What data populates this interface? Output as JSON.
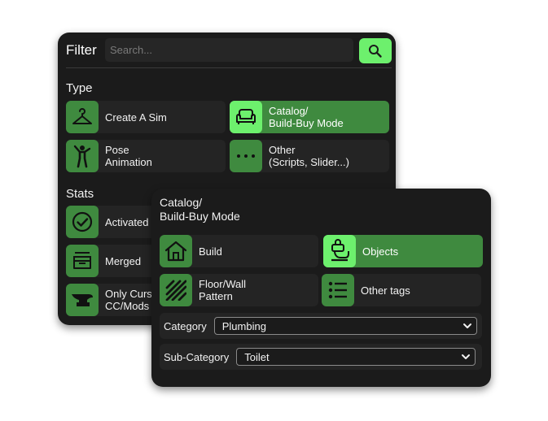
{
  "filter": {
    "title": "Filter",
    "search_placeholder": "Search...",
    "type_label": "Type",
    "stats_label": "Stats",
    "type_items": [
      {
        "label": "Create A Sim",
        "icon": "hanger-icon",
        "active": false
      },
      {
        "label": "Catalog/\nBuild-Buy Mode",
        "icon": "sofa-icon",
        "active": true
      },
      {
        "label": "Pose\nAnimation",
        "icon": "pose-icon",
        "active": false
      },
      {
        "label": "Other\n(Scripts, Slider...)",
        "icon": "ellipsis-icon",
        "active": false
      }
    ],
    "stats_items": [
      {
        "label": "Activated",
        "icon": "check-circle-icon"
      },
      {
        "label": "Merged",
        "icon": "merge-box-icon"
      },
      {
        "label": "Only Curs\nCC/Mods",
        "icon": "anvil-icon"
      }
    ]
  },
  "popup": {
    "title": "Catalog/\nBuild-Buy Mode",
    "items": [
      {
        "label": "Build",
        "icon": "house-icon",
        "active": false
      },
      {
        "label": "Objects",
        "icon": "objects-icon",
        "active": true
      },
      {
        "label": "Floor/Wall\nPattern",
        "icon": "stripes-icon",
        "active": false
      },
      {
        "label": "Other tags",
        "icon": "list-icon",
        "active": false
      }
    ],
    "category_label": "Category",
    "category_value": "Plumbing",
    "subcategory_label": "Sub-Category",
    "subcategory_value": "Toilet"
  },
  "colors": {
    "panel_bg": "#1b1b1b",
    "tile_bg": "#242424",
    "accent_dark": "#3f8a3f",
    "accent_bright": "#6df06d"
  }
}
